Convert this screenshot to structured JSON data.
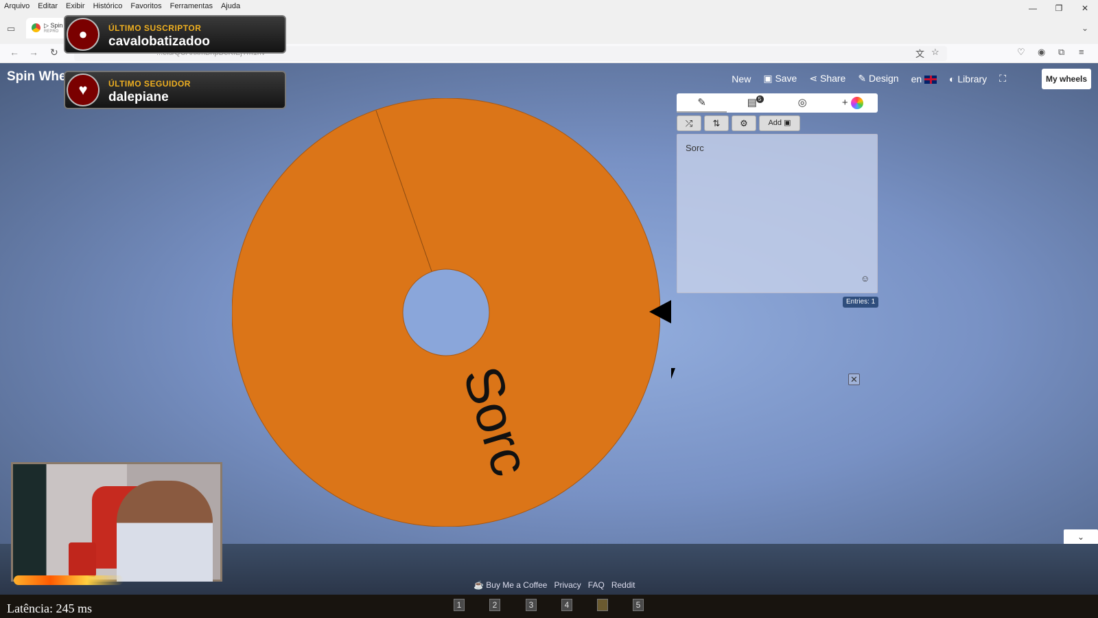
{
  "browser": {
    "menu": [
      "Arquivo",
      "Editar",
      "Exibir",
      "Histórico",
      "Favoritos",
      "Ferramentas",
      "Ajuda"
    ],
    "tab_title": "▷ Spin",
    "tab_subtitle": "REPRO",
    "url": "...els/QUAhxmBnpDeKIEjTm1nv",
    "window_controls": [
      "—",
      "❐",
      "✕"
    ]
  },
  "app": {
    "brand": "Spin Whe",
    "nav": {
      "new": "New",
      "save": "Save",
      "share": "Share",
      "design": "Design",
      "lang": "en",
      "library": "Library"
    },
    "my_wheels": "My wheels",
    "wheel": {
      "segment_label": "Sorc",
      "color": "#db7518",
      "hub_color": "#8aa6da"
    },
    "panel": {
      "list_badge": "5",
      "add_label": "Add",
      "entries_text": "Sorc",
      "entries_count": "Entries: 1"
    },
    "footer_links": [
      "Buy Me a Coffee",
      "Privacy",
      "FAQ",
      "Reddit"
    ]
  },
  "overlay": {
    "alert1_label": "ÚLTIMO SUSCRIPTOR",
    "alert1_value": "cavalobatizadoo",
    "alert2_label": "ÚLTIMO SEGUIDOR",
    "alert2_value": "dalepiane",
    "latency": "Latência: 245 ms",
    "slots": [
      "1",
      "2",
      "3",
      "4",
      "5"
    ]
  }
}
